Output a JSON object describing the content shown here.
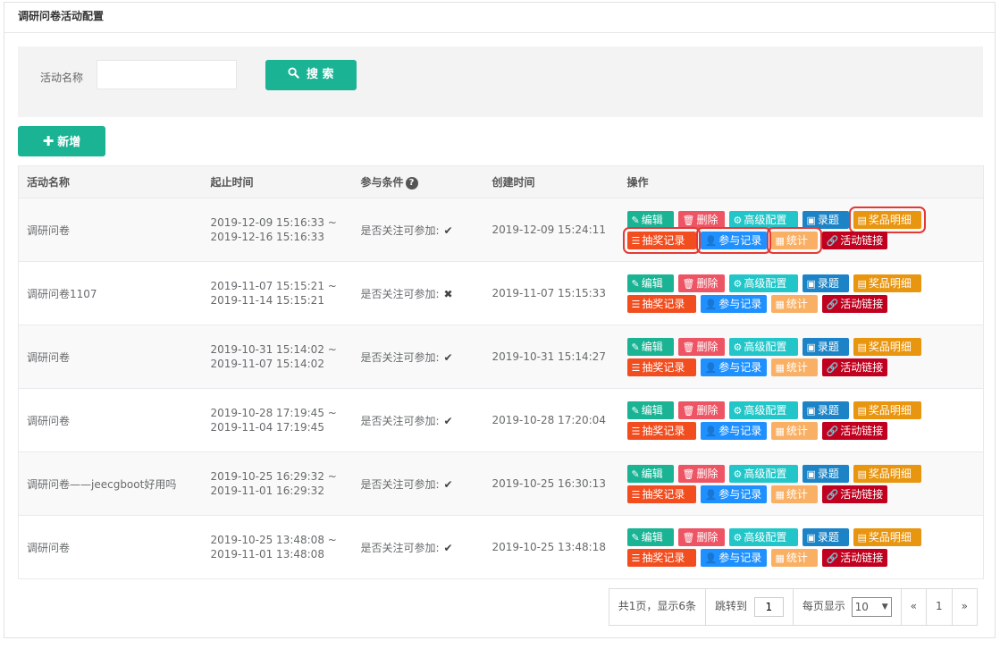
{
  "panel": {
    "title": "调研问卷活动配置"
  },
  "search": {
    "label": "活动名称",
    "value": "",
    "placeholder": "",
    "button_icon": "search-icon",
    "button_label": "搜 索"
  },
  "toolbar": {
    "add_icon": "plus-icon",
    "add_label": "新增"
  },
  "table": {
    "headers": {
      "name": "活动名称",
      "time": "起止时间",
      "condition": "参与条件",
      "condition_help_icon": "question-circle-icon",
      "created": "创建时间",
      "ops": "操作"
    },
    "actions": {
      "edit": "编辑",
      "delete": "删除",
      "advanced": "高级配置",
      "topic": "录题",
      "prize": "奖品明细",
      "draw": "抽奖记录",
      "join": "参与记录",
      "stat": "统计",
      "link": "活动链接"
    },
    "rows": [
      {
        "name": "调研问卷",
        "start": "2019-12-09 15:16:33 ~",
        "end": "2019-12-16 15:16:33",
        "condition": "是否关注可参加:",
        "mark": "✔",
        "created": "2019-12-09 15:24:11"
      },
      {
        "name": "调研问卷1107",
        "start": "2019-11-07 15:15:21 ~",
        "end": "2019-11-14 15:15:21",
        "condition": "是否关注可参加:",
        "mark": "✖",
        "created": "2019-11-07 15:15:33"
      },
      {
        "name": "调研问卷",
        "start": "2019-10-31 15:14:02 ~",
        "end": "2019-11-07 15:14:02",
        "condition": "是否关注可参加:",
        "mark": "✔",
        "created": "2019-10-31 15:14:27"
      },
      {
        "name": "调研问卷",
        "start": "2019-10-28 17:19:45 ~",
        "end": "2019-11-04 17:19:45",
        "condition": "是否关注可参加:",
        "mark": "✔",
        "created": "2019-10-28 17:20:04"
      },
      {
        "name": "调研问卷——jeecgboot好用吗",
        "start": "2019-10-25 16:29:32 ~",
        "end": "2019-11-01 16:29:32",
        "condition": "是否关注可参加:",
        "mark": "✔",
        "created": "2019-10-25 16:30:13"
      },
      {
        "name": "调研问卷",
        "start": "2019-10-25 13:48:08 ~",
        "end": "2019-11-01 13:48:08",
        "condition": "是否关注可参加:",
        "mark": "✔",
        "created": "2019-10-25 13:48:18"
      }
    ]
  },
  "pager": {
    "summary": "共1页，显示6条",
    "jump_label": "跳转到",
    "jump_value": "1",
    "per_page_label": "每页显示",
    "per_page_value": "10",
    "prev": "«",
    "current": "1",
    "next": "»"
  }
}
